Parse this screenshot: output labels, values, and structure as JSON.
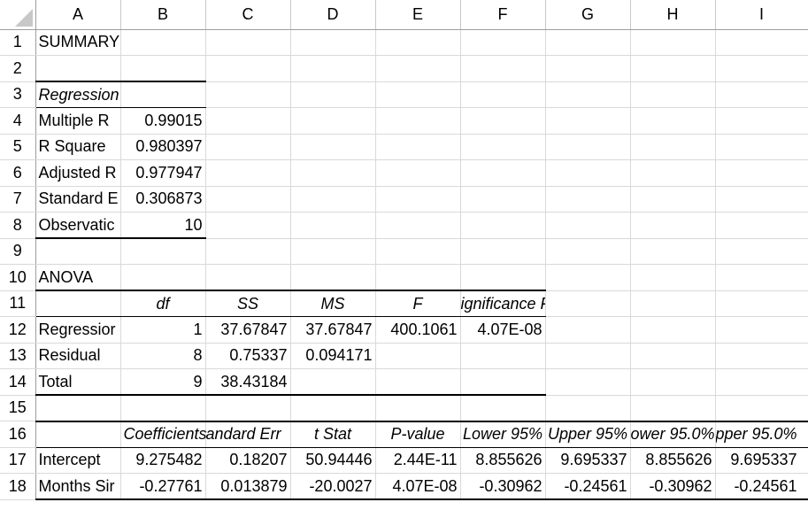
{
  "columns": [
    "A",
    "B",
    "C",
    "D",
    "E",
    "F",
    "G",
    "H",
    "I"
  ],
  "rows": [
    "1",
    "2",
    "3",
    "4",
    "5",
    "6",
    "7",
    "8",
    "9",
    "10",
    "11",
    "12",
    "13",
    "14",
    "15",
    "16",
    "17",
    "18"
  ],
  "summary_title": "SUMMARY OUTPUT",
  "regression_statistics": {
    "header": "Regression Statistics",
    "rows": [
      {
        "label": "Multiple R",
        "label_shown": "Multiple R",
        "value": "0.99015"
      },
      {
        "label": "R Square",
        "label_shown": "R Square",
        "value": "0.980397"
      },
      {
        "label": "Adjusted R Square",
        "label_shown": "Adjusted R",
        "value": "0.977947"
      },
      {
        "label": "Standard Error",
        "label_shown": "Standard E",
        "value": "0.306873"
      },
      {
        "label": "Observations",
        "label_shown": "Observatic",
        "value": "10"
      }
    ]
  },
  "anova": {
    "title": "ANOVA",
    "headers": [
      "df",
      "SS",
      "MS",
      "F",
      "ignificance F"
    ],
    "rows": [
      {
        "label": "Regressior",
        "df": "1",
        "ss": "37.67847",
        "ms": "37.67847",
        "f": "400.1061",
        "sig": "4.07E-08"
      },
      {
        "label": "Residual",
        "df": "8",
        "ss": "0.75337",
        "ms": "0.094171",
        "f": "",
        "sig": ""
      },
      {
        "label": "Total",
        "df": "9",
        "ss": "38.43184",
        "ms": "",
        "f": "",
        "sig": ""
      }
    ]
  },
  "coefficients": {
    "headers": [
      "Coefficients",
      "andard Err",
      "t Stat",
      "P-value",
      "Lower 95%",
      "Upper 95%",
      "ower 95.0%",
      "pper 95.0%"
    ],
    "rows": [
      {
        "label": "Intercept",
        "values": [
          "9.275482",
          "0.18207",
          "50.94446",
          "2.44E-11",
          "8.855626",
          "9.695337",
          "8.855626",
          "9.695337"
        ]
      },
      {
        "label": "Months Sir",
        "values": [
          "-0.27761",
          "0.013879",
          "-20.0027",
          "4.07E-08",
          "-0.30962",
          "-0.24561",
          "-0.30962",
          "-0.24561"
        ]
      }
    ]
  }
}
